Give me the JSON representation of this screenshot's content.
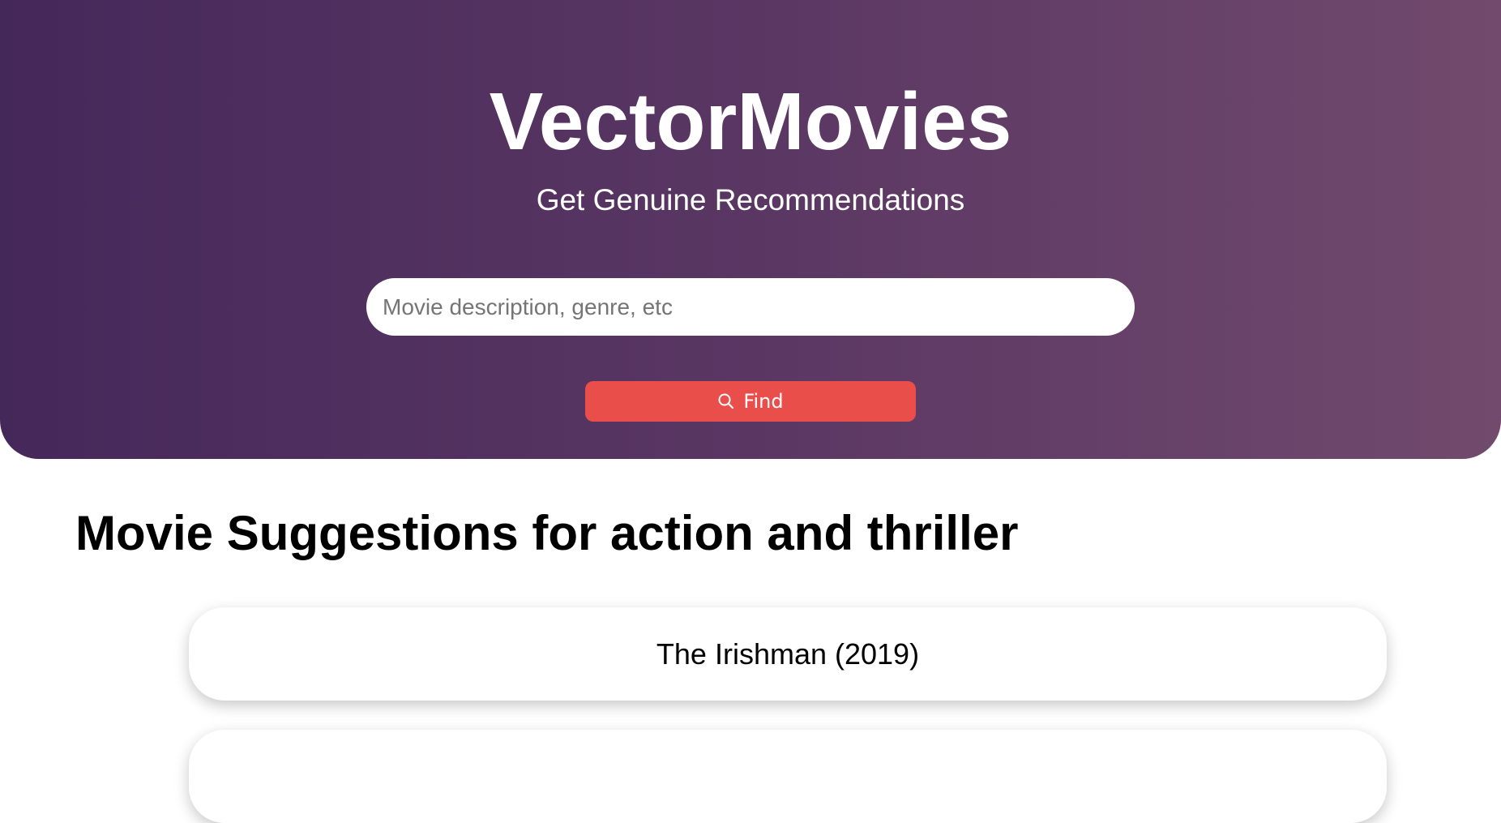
{
  "header": {
    "title": "VectorMovies",
    "subtitle": "Get Genuine Recommendations"
  },
  "search": {
    "value": "",
    "placeholder": "Movie description, genre, etc",
    "button_label": "Find",
    "button_icon": "search-icon"
  },
  "results": {
    "heading": "Movie Suggestions for action and thriller",
    "movies": [
      {
        "title": "The Irishman (2019)"
      },
      {
        "title": ""
      }
    ]
  },
  "colors": {
    "hero_gradient_start": "#45285a",
    "hero_gradient_end": "#714a6d",
    "find_button": "#ea4e4b",
    "card_background": "#ffffff"
  }
}
